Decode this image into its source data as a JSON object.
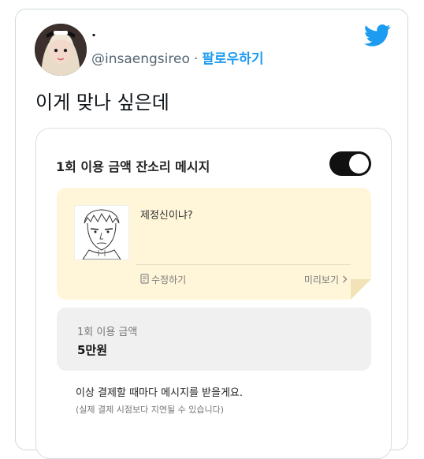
{
  "tweet": {
    "author_name": "·",
    "handle": "@insaengsireo",
    "separator": "·",
    "follow_label": "팔로우하기",
    "text": "이게 맞나 싶은데",
    "twitter_icon": "twitter-bird-icon",
    "brand_color": "#1d9bf0"
  },
  "embed": {
    "title": "1회 이용 금액 잔소리 메시지",
    "toggle_on": true,
    "message": {
      "text": "제정신이냐?",
      "edit_label": "수정하기",
      "preview_label": "미리보기"
    },
    "amount": {
      "label": "1회 이용 금액",
      "value": "5만원"
    },
    "notice": "이상 결제할 때마다 메시지를 받을게요.",
    "subnotice": "(실제 결제 시점보다 지연될 수 있습니다)"
  }
}
